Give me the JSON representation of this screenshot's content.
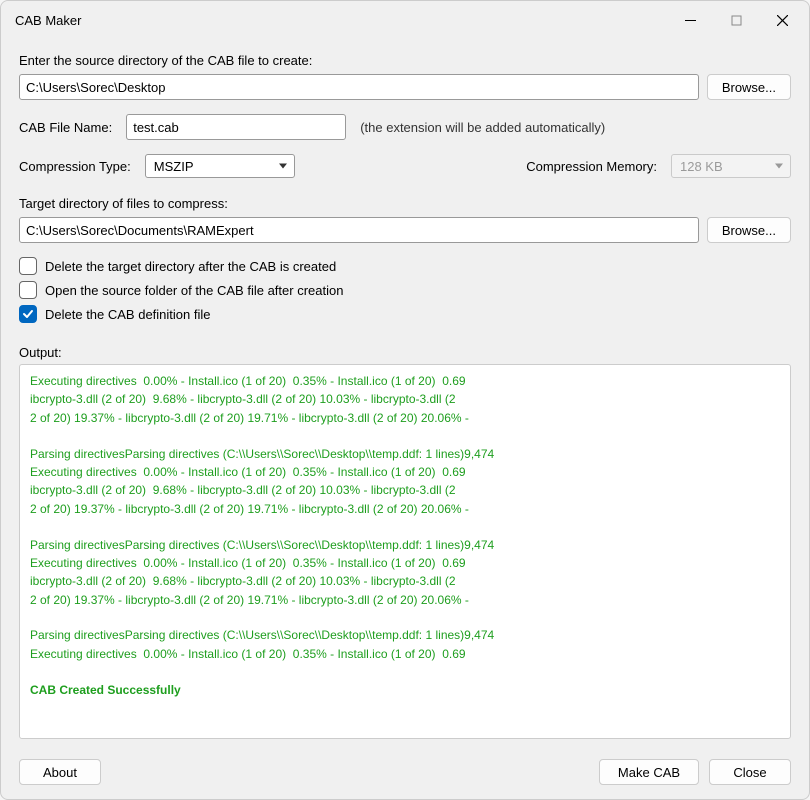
{
  "window": {
    "title": "CAB Maker"
  },
  "source": {
    "label": "Enter the source directory of the CAB file to create:",
    "value": "C:\\Users\\Sorec\\Desktop",
    "browse": "Browse..."
  },
  "cabname": {
    "label": "CAB File Name:",
    "value": "test.cab",
    "hint": "(the extension will be added automatically)"
  },
  "compression": {
    "type_label": "Compression Type:",
    "type_value": "MSZIP",
    "memory_label": "Compression Memory:",
    "memory_value": "128 KB"
  },
  "target": {
    "label": "Target directory of files to compress:",
    "value": "C:\\Users\\Sorec\\Documents\\RAMExpert",
    "browse": "Browse..."
  },
  "checkboxes": {
    "delete_target": {
      "label": "Delete the target directory after the CAB is created",
      "checked": false
    },
    "open_source": {
      "label": "Open the source folder of the CAB file after creation",
      "checked": false
    },
    "delete_def": {
      "label": "Delete the CAB definition file",
      "checked": true
    }
  },
  "output": {
    "label": "Output:",
    "block_exec": "Executing directives  0.00% - Install.ico (1 of 20)  0.35% - Install.ico (1 of 20)  0.69",
    "block_lib1": "ibcrypto-3.dll (2 of 20)  9.68% - libcrypto-3.dll (2 of 20) 10.03% - libcrypto-3.dll (2",
    "block_lib2": "2 of 20) 19.37% - libcrypto-3.dll (2 of 20) 19.71% - libcrypto-3.dll (2 of 20) 20.06% -",
    "block_parse": "Parsing directivesParsing directives (C:\\\\Users\\\\Sorec\\\\Desktop\\\\temp.ddf: 1 lines)9,474",
    "success": "CAB Created Successfully"
  },
  "footer": {
    "about": "About",
    "make": "Make CAB",
    "close": "Close"
  }
}
